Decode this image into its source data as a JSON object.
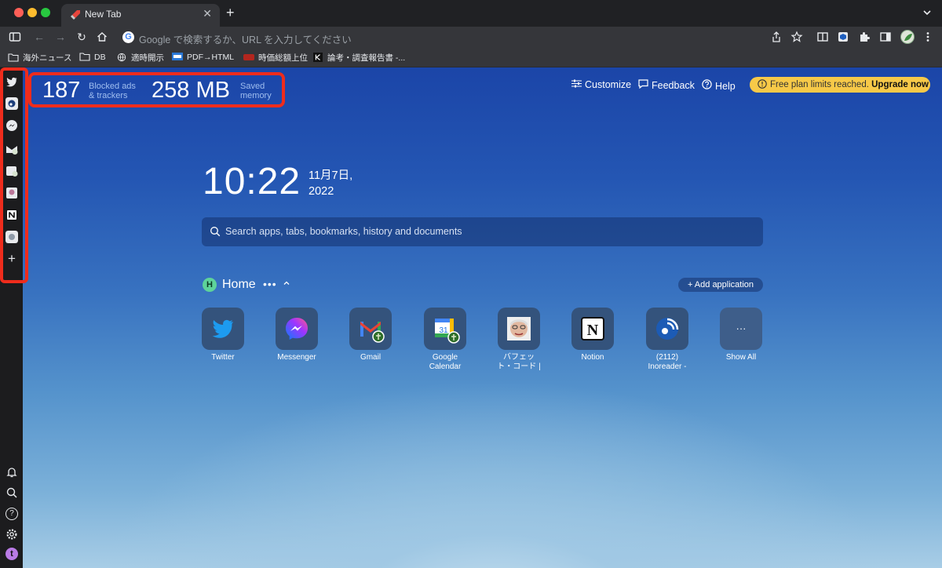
{
  "browser": {
    "tab": {
      "title": "New Tab"
    },
    "new_tab_label": "+",
    "omnibox": {
      "placeholder": "Google で検索するか、URL を入力してください",
      "logo_letter": "G"
    },
    "bookmarks": [
      {
        "label": "海外ニュース",
        "icon": "folder-icon"
      },
      {
        "label": "DB",
        "icon": "folder-icon"
      },
      {
        "label": "適時開示",
        "icon": "globe-icon"
      },
      {
        "label": "PDF→HTML",
        "icon": "pdf-icon"
      },
      {
        "label": "時価総額上位",
        "icon": "site-icon"
      },
      {
        "label": "論考・調査報告書 -...",
        "icon": "k-icon"
      }
    ]
  },
  "rail": {
    "apps": [
      "twitter-icon",
      "inoreader-icon",
      "messenger-icon",
      "gmail-icon",
      "calendar-icon",
      "buffett-icon",
      "notion-icon",
      "extra-icon"
    ],
    "add_label": "+",
    "bottom": [
      "bell-icon",
      "search-icon",
      "help-icon",
      "settings-icon",
      "profile-icon"
    ],
    "profile_letter": "t",
    "help_label": "?"
  },
  "stats": {
    "blocked_count": "187",
    "blocked_label_1": "Blocked ads",
    "blocked_label_2": "& trackers",
    "memory": "258 MB",
    "memory_label_1": "Saved",
    "memory_label_2": "memory"
  },
  "topnav": {
    "customize": "Customize",
    "feedback": "Feedback",
    "help": "Help",
    "upgrade_msg": "Free plan limits reached.",
    "upgrade_cta": "Upgrade now"
  },
  "clock": {
    "time": "10:22",
    "date_line1": "11月7日,",
    "date_line2": "2022"
  },
  "search": {
    "placeholder": "Search apps, tabs, bookmarks, history and documents"
  },
  "home": {
    "badge": "H",
    "title": "Home",
    "dots": "•••",
    "add_app": "+ Add application",
    "apps": [
      {
        "label": "Twitter",
        "label2": "",
        "icon": "twitter-icon"
      },
      {
        "label": "Messenger",
        "label2": "",
        "icon": "messenger-icon"
      },
      {
        "label": "Gmail",
        "label2": "",
        "icon": "gmail-icon"
      },
      {
        "label": "Google",
        "label2": "Calendar",
        "icon": "calendar-icon",
        "day": "31"
      },
      {
        "label": "バフェッ",
        "label2": "ト・コード |",
        "icon": "buffett-icon"
      },
      {
        "label": "Notion",
        "label2": "",
        "icon": "notion-icon",
        "glyph": "N"
      },
      {
        "label": "(2112)",
        "label2": "Inoreader -",
        "icon": "inoreader-icon"
      },
      {
        "label": "Show All",
        "label2": "",
        "icon": "more-icon",
        "glyph": "···"
      }
    ]
  },
  "colors": {
    "highlight": "#ef2c1c",
    "upgrade_bg": "#f7c948",
    "home_badge": "#5ed39a"
  }
}
